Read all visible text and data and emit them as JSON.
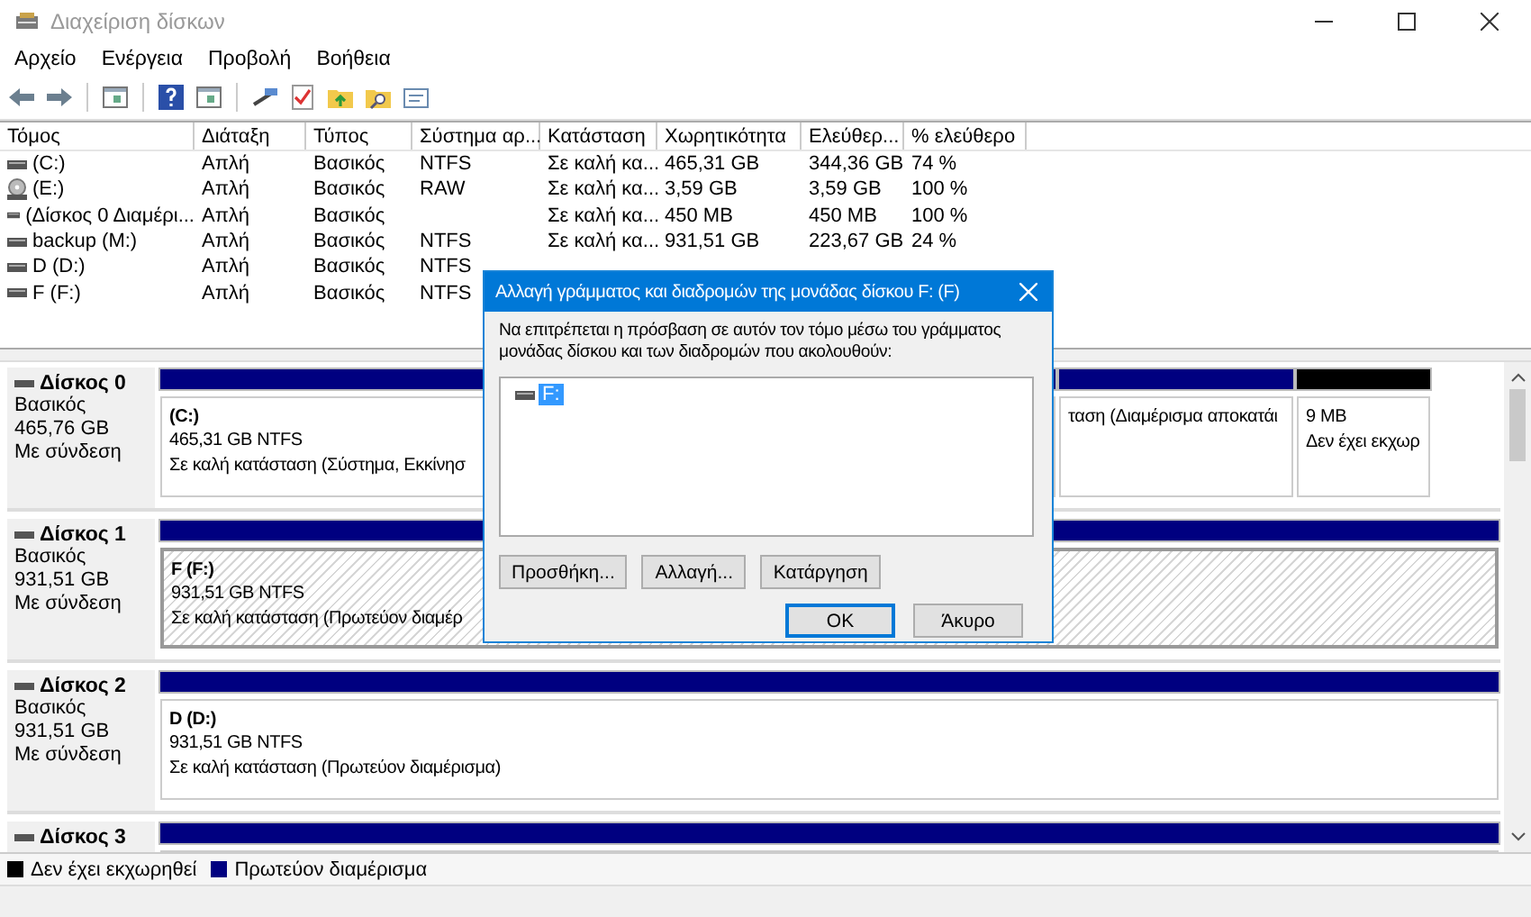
{
  "window": {
    "title": "Διαχείριση δίσκων"
  },
  "menu": [
    {
      "label": "Αρχείο"
    },
    {
      "label": "Ενέργεια"
    },
    {
      "label": "Προβολή"
    },
    {
      "label": "Βοήθεια"
    }
  ],
  "table": {
    "columns": [
      "Τόμος",
      "Διάταξη",
      "Τύπος",
      "Σύστημα αρ...",
      "Κατάσταση",
      "Χωρητικότητα",
      "Ελεύθερ...",
      "% ελεύθερο"
    ],
    "rows": [
      {
        "kind": "disk",
        "cells": [
          "(C:)",
          "Απλή",
          "Βασικός",
          "NTFS",
          "Σε καλή κα...",
          "465,31 GB",
          "344,36 GB",
          "74 %"
        ]
      },
      {
        "kind": "removable",
        "cells": [
          "(E:)",
          "Απλή",
          "Βασικός",
          "RAW",
          "Σε καλή κα...",
          "3,59 GB",
          "3,59 GB",
          "100 %"
        ]
      },
      {
        "kind": "disk",
        "cells": [
          "(Δίσκος 0 Διαμέρι...",
          "Απλή",
          "Βασικός",
          "",
          "Σε καλή κα...",
          "450 MB",
          "450 MB",
          "100 %"
        ]
      },
      {
        "kind": "disk",
        "cells": [
          "backup (M:)",
          "Απλή",
          "Βασικός",
          "NTFS",
          "Σε καλή κα...",
          "931,51 GB",
          "223,67 GB",
          "24 %"
        ]
      },
      {
        "kind": "disk",
        "cells": [
          "D (D:)",
          "Απλή",
          "Βασικός",
          "NTFS"
        ]
      },
      {
        "kind": "disk",
        "cells": [
          "F (F:)",
          "Απλή",
          "Βασικός",
          "NTFS"
        ]
      }
    ]
  },
  "disks": [
    {
      "name": "Δίσκος 0",
      "type": "Βασικός",
      "size": "465,76 GB",
      "status": "Με σύνδεση",
      "partitions": [
        {
          "kind": "primary",
          "selected": false,
          "name": "(C:)",
          "size": "465,31 GB NTFS",
          "status": "Σε καλή κατάσταση (Σύστημα, Εκκίνησ"
        },
        {
          "kind": "primary",
          "selected": false,
          "status": "ταση (Διαμέρισμα αποκατάι"
        },
        {
          "kind": "unallocated",
          "selected": false,
          "size": "9 MB",
          "status": "Δεν έχει εκχωρ"
        }
      ]
    },
    {
      "name": "Δίσκος 1",
      "type": "Βασικός",
      "size": "931,51 GB",
      "status": "Με σύνδεση",
      "partitions": [
        {
          "kind": "primary",
          "selected": true,
          "name": "F  (F:)",
          "size": "931,51 GB NTFS",
          "status": "Σε καλή κατάσταση (Πρωτεύον διαμέρ"
        }
      ]
    },
    {
      "name": "Δίσκος 2",
      "type": "Βασικός",
      "size": "931,51 GB",
      "status": "Με σύνδεση",
      "partitions": [
        {
          "kind": "primary",
          "selected": false,
          "name": "D  (D:)",
          "size": "931,51 GB NTFS",
          "status": "Σε καλή κατάσταση (Πρωτεύον διαμέρισμα)"
        }
      ]
    },
    {
      "name": "Δίσκος 3",
      "partitions": [
        {
          "kind": "primary"
        }
      ]
    }
  ],
  "legend": [
    {
      "label": "Δεν έχει εκχωρηθεί",
      "color": "#000000"
    },
    {
      "label": "Πρωτεύον διαμέρισμα",
      "color": "#000080"
    }
  ],
  "dialog": {
    "title": "Αλλαγή γράμματος και διαδρομών της μονάδας δίσκου F: (F)",
    "text": "Να επιτρέπεται η πρόσβαση σε αυτόν τον τόμο μέσω του γράμματος μονάδας δίσκου και των διαδρομών που ακολουθούν:",
    "items": [
      {
        "label": "F:",
        "selected": true
      }
    ],
    "actions": [
      "Προσθήκη...",
      "Αλλαγή...",
      "Κατάργηση"
    ],
    "buttons": [
      {
        "label": "OK",
        "default": true
      },
      {
        "label": "Άκυρο",
        "default": false
      }
    ]
  }
}
